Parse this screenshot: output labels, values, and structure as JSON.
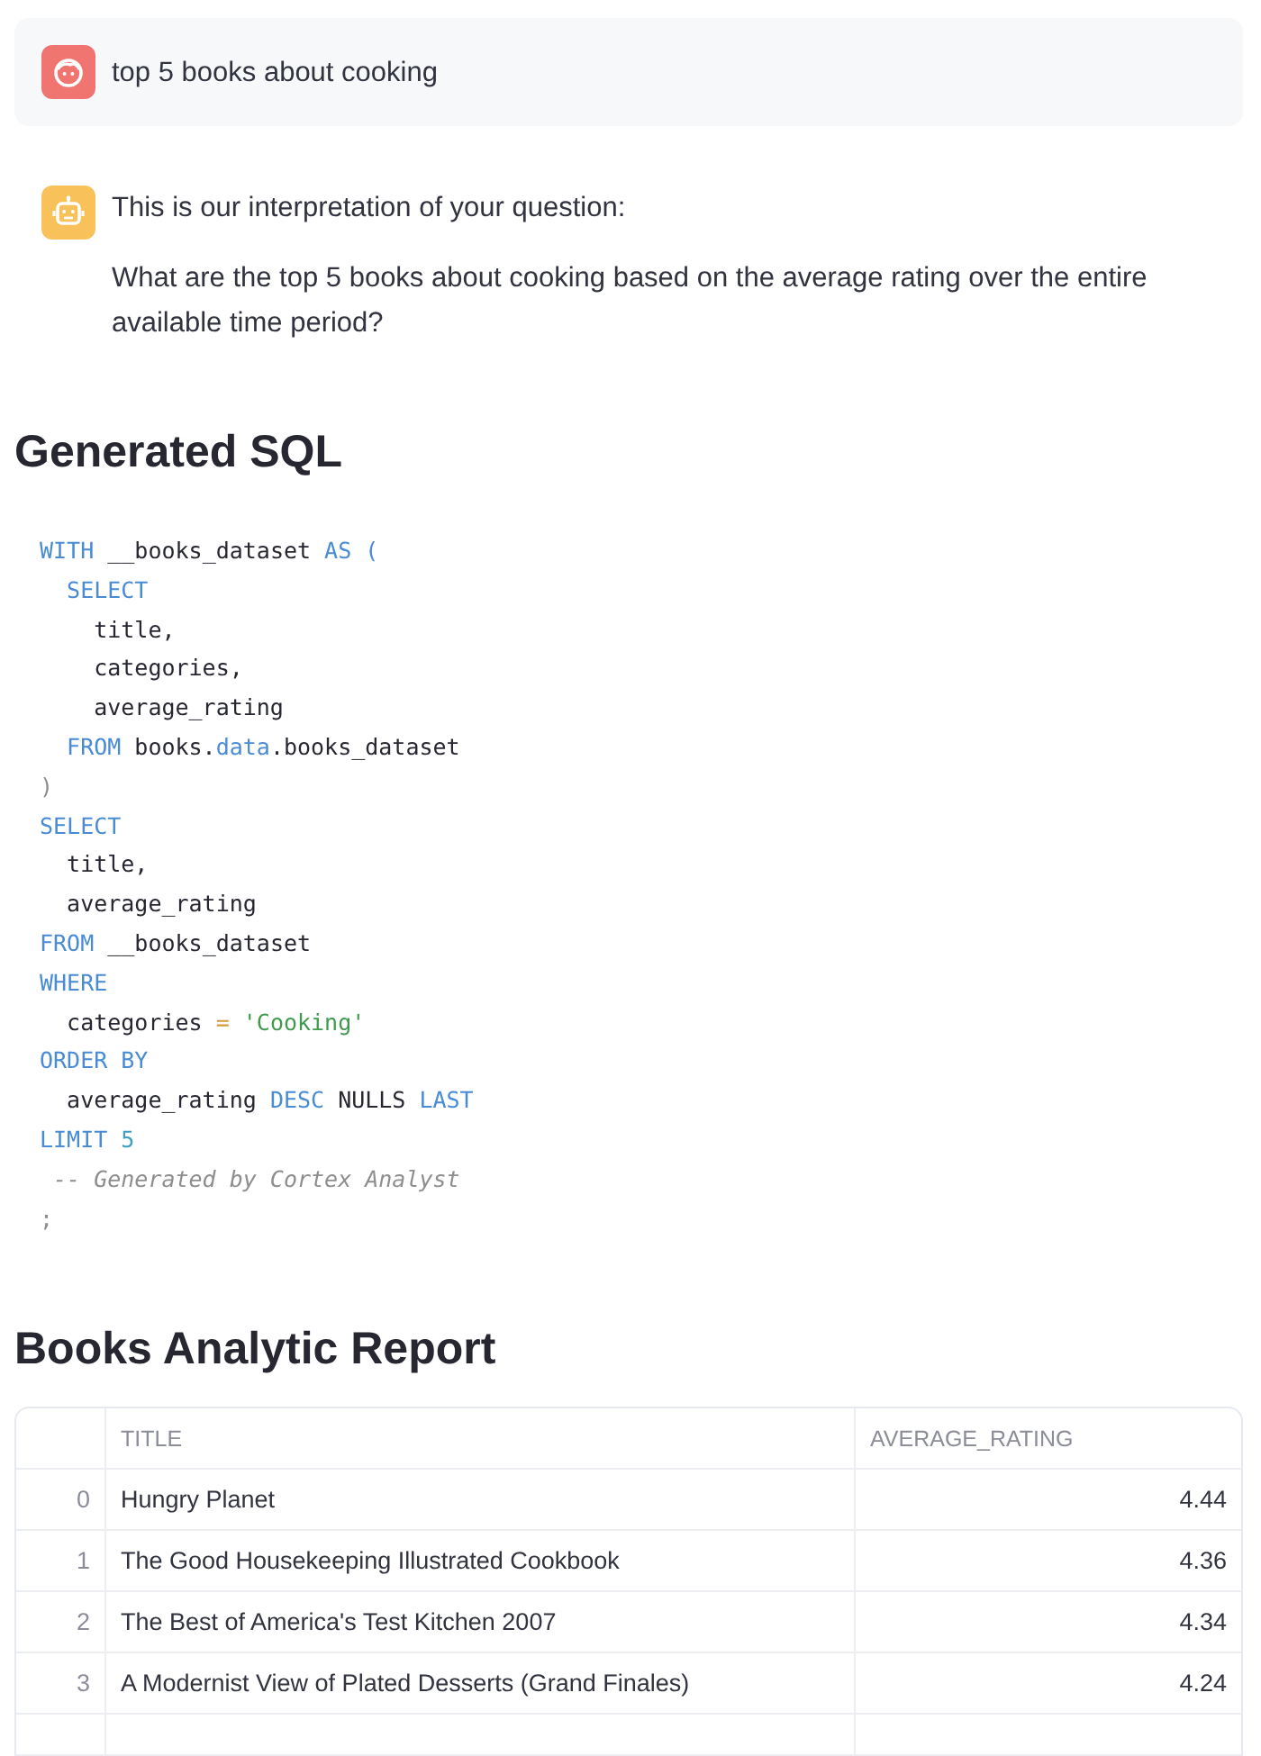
{
  "user_message": {
    "text": "top 5 books about cooking"
  },
  "assistant_message": {
    "paragraphs": [
      "This is our interpretation of your question:",
      "What are the top 5 books about cooking based on the average rating over the entire available time period?"
    ]
  },
  "sql_section": {
    "heading": "Generated SQL",
    "code_lines": [
      {
        "tokens": [
          {
            "kind": "keyword",
            "text": "WITH"
          },
          {
            "kind": "plain",
            "text": " __books_dataset "
          },
          {
            "kind": "keyword",
            "text": "AS ("
          }
        ]
      },
      {
        "tokens": [
          {
            "kind": "keyword",
            "text": "  SELECT"
          }
        ]
      },
      {
        "tokens": [
          {
            "kind": "plain",
            "text": "    title,"
          }
        ]
      },
      {
        "tokens": [
          {
            "kind": "plain",
            "text": "    categories,"
          }
        ]
      },
      {
        "tokens": [
          {
            "kind": "plain",
            "text": "    average_rating"
          }
        ]
      },
      {
        "tokens": [
          {
            "kind": "keyword",
            "text": "  FROM"
          },
          {
            "kind": "plain",
            "text": " books."
          },
          {
            "kind": "keyword",
            "text": "data"
          },
          {
            "kind": "plain",
            "text": ".books_dataset"
          }
        ]
      },
      {
        "tokens": [
          {
            "kind": "punct",
            "text": ")"
          }
        ]
      },
      {
        "tokens": [
          {
            "kind": "keyword",
            "text": "SELECT"
          }
        ]
      },
      {
        "tokens": [
          {
            "kind": "plain",
            "text": "  title,"
          }
        ]
      },
      {
        "tokens": [
          {
            "kind": "plain",
            "text": "  average_rating"
          }
        ]
      },
      {
        "tokens": [
          {
            "kind": "keyword",
            "text": "FROM"
          },
          {
            "kind": "plain",
            "text": " __books_dataset"
          }
        ]
      },
      {
        "tokens": [
          {
            "kind": "keyword",
            "text": "WHERE"
          }
        ]
      },
      {
        "tokens": [
          {
            "kind": "plain",
            "text": "  categories "
          },
          {
            "kind": "operator",
            "text": "="
          },
          {
            "kind": "string",
            "text": " 'Cooking'"
          }
        ]
      },
      {
        "tokens": [
          {
            "kind": "keyword",
            "text": "ORDER BY"
          }
        ]
      },
      {
        "tokens": [
          {
            "kind": "plain",
            "text": "  average_rating "
          },
          {
            "kind": "keyword",
            "text": "DESC"
          },
          {
            "kind": "plain",
            "text": " NULLS "
          },
          {
            "kind": "keyword",
            "text": "LAST"
          }
        ]
      },
      {
        "tokens": [
          {
            "kind": "keyword",
            "text": "LIMIT "
          },
          {
            "kind": "number",
            "text": "5"
          }
        ]
      },
      {
        "tokens": [
          {
            "kind": "comment",
            "text": " -- Generated by Cortex Analyst"
          }
        ]
      },
      {
        "tokens": [
          {
            "kind": "punct",
            "text": ";"
          }
        ]
      }
    ]
  },
  "report_section": {
    "heading": "Books Analytic Report",
    "table": {
      "columns": [
        "TITLE",
        "AVERAGE_RATING"
      ],
      "rows": [
        {
          "index": "0",
          "title": "Hungry Planet",
          "average_rating": "4.44"
        },
        {
          "index": "1",
          "title": "The Good Housekeeping Illustrated Cookbook",
          "average_rating": "4.36"
        },
        {
          "index": "2",
          "title": "The Best of America's Test Kitchen 2007",
          "average_rating": "4.34"
        },
        {
          "index": "3",
          "title": "A Modernist View of Plated Desserts (Grand Finales)",
          "average_rating": "4.24"
        }
      ]
    }
  }
}
